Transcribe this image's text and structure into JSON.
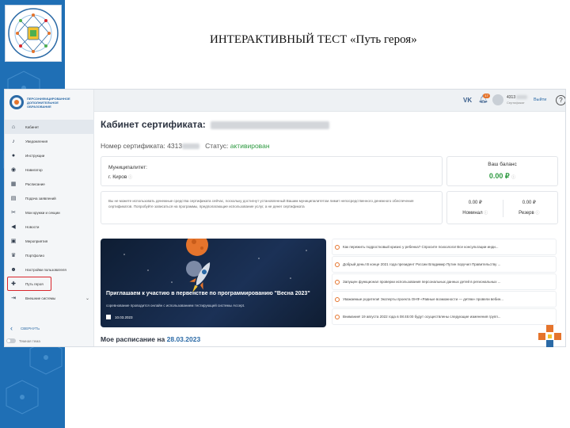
{
  "slide": {
    "title": "ИНТЕРАКТИВНЫЙ ТЕСТ «Путь героя»",
    "logo_text": "ПЕРСОНИФИЦИРОВАННОЕ ДОПОЛНИТЕЛЬНОЕ ОБРАЗОВАНИЕ ДЕТЕЙ"
  },
  "brand": {
    "text": "ПЕРСОНИФИЦИРОВАННОЕ ДОПОЛНИТЕЛЬНОЕ ОБРАЗОВАНИЕ"
  },
  "sidebar": {
    "items": [
      {
        "label": "Кабинет",
        "icon": "home-icon"
      },
      {
        "label": "Уведомления",
        "icon": "bell-icon"
      },
      {
        "label": "Инструкции",
        "icon": "help-icon"
      },
      {
        "label": "Навигатор",
        "icon": "compass-icon"
      },
      {
        "label": "Расписание",
        "icon": "calendar-icon"
      },
      {
        "label": "Подача заявлений",
        "icon": "document-icon"
      },
      {
        "label": "Мои кружки и секции",
        "icon": "activities-icon"
      },
      {
        "label": "Новости",
        "icon": "megaphone-icon"
      },
      {
        "label": "Мероприятия",
        "icon": "event-icon"
      },
      {
        "label": "Портфолио",
        "icon": "trophy-icon"
      },
      {
        "label": "Настройки пользователя",
        "icon": "user-icon"
      },
      {
        "label": "Путь героя",
        "icon": "gamepad-icon"
      },
      {
        "label": "Внешние системы",
        "icon": "external-icon"
      }
    ],
    "collapse_label": "СВЕРНУТЬ",
    "dark_theme_label": "Темная тема"
  },
  "topbar": {
    "vk": "VK",
    "notifications_count": "17",
    "user_number": "4313",
    "user_role": "Сертификат",
    "logout": "Выйти",
    "help": "?"
  },
  "main": {
    "title": "Кабинет сертификата:",
    "cert_label": "Номер сертификата:",
    "cert_number": "4313",
    "status_label": "Статус:",
    "status_value": "активирован",
    "municipality_label": "Муниципалитет:",
    "municipality_value": "г. Киров",
    "balance_label": "Ваш баланс",
    "balance_value": "0.00 ₽",
    "notice": "Вы не можете использовать денежные средства сертификата сейчас, поскольку достигнут установленный Вашим муниципалитетом лимит непосредственного денежного обеспечения сертификатов. Попробуйте записаться на программы, предполагающие использование услуг, а не денег сертификата",
    "nominal_value": "0.00 ₽",
    "nominal_label": "Номинал",
    "reserve_value": "0.00 ₽",
    "reserve_label": "Резерв",
    "banner_title": "Приглашаем к участию в первенстве по программированию \"Весна 2023\"",
    "banner_sub": "соревнование проводится онлайн с использованием тестирующей системы Accept.",
    "banner_date": "10.03.2023",
    "news": [
      "Как пережить подростковый кризис у ребенка? Спросите психолога! Все консультации инди...",
      "Добрый день! В конце 2021 года президент России Владимир Путин поручил Правительству ...",
      "Запущен функционал проверки использования персональных данных детей в региональных ...",
      "Уважаемые родители! Эксперты проекта ОНФ «Равные возможности — детям» провели вебин...",
      "Внимание! 19 августа 2022 года в 08:45:00 будут осуществлены следующие изменения групп..."
    ],
    "schedule_label": "Мое расписание на",
    "schedule_date": "28.03.2023"
  },
  "colors": {
    "accent": "#2b6aa6",
    "status": "#2e9a41",
    "highlight": "#d9252b",
    "orange": "#e5742c"
  }
}
